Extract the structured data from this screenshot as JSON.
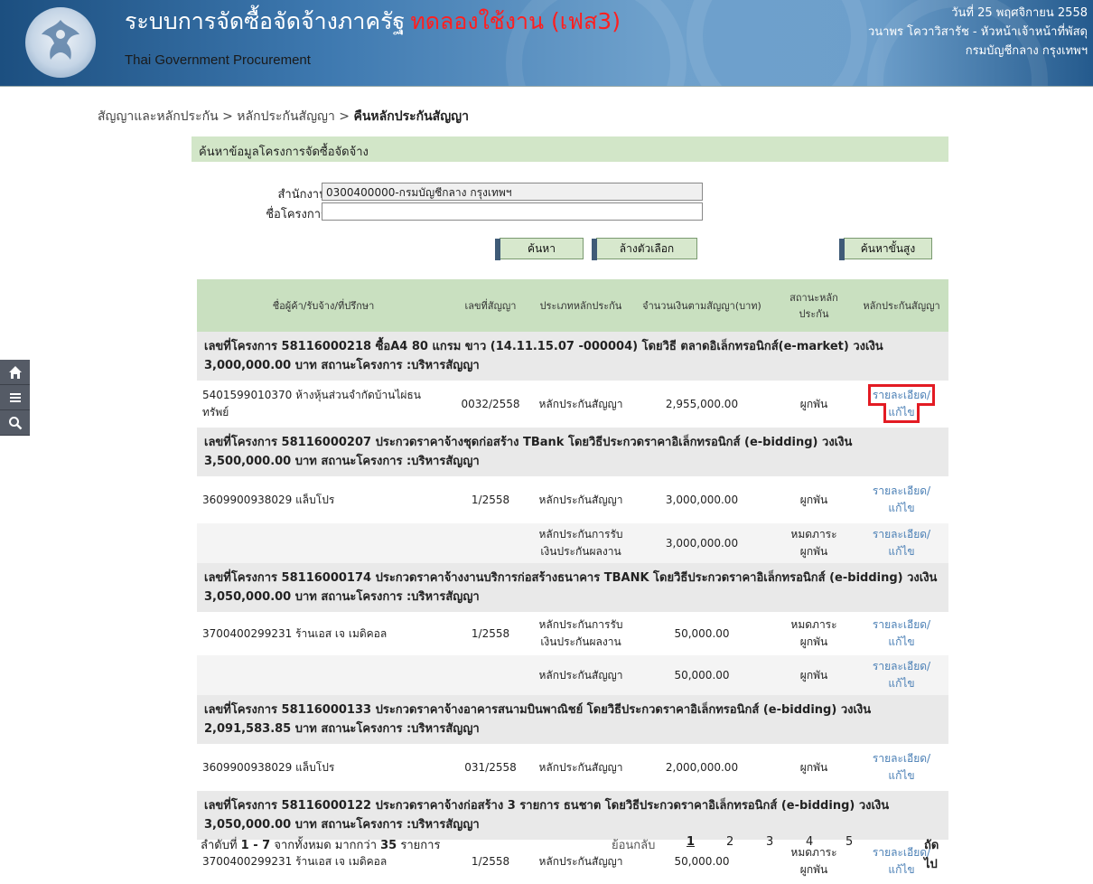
{
  "header": {
    "title": "ระบบการจัดซื้อจัดจ้างภาครัฐ",
    "trial_label": "ทดลองใช้งาน (เฟส3)",
    "subtitle": "Thai Government Procurement",
    "date": "วันที่ 25 พฤศจิกายน 2558",
    "user": "วนาพร โควาวิสารัช - หัวหน้าเจ้าหน้าที่พัสดุ",
    "department": "กรมบัญชีกลาง กรุงเทพฯ",
    "colors": {
      "bar": "#3e79b0",
      "trial": "#ff1f1f"
    }
  },
  "breadcrumb": {
    "item1": "สัญญาและหลักประกัน",
    "sep": ">",
    "item2": "หลักประกันสัญญา",
    "current": "คืนหลักประกันสัญญา"
  },
  "side_tools": [
    "home-icon",
    "menu-icon",
    "search-icon"
  ],
  "search_panel": {
    "heading": "ค้นหาข้อมูลโครงการจัดซื้อจัดจ้าง",
    "agency_label": "สำนักงาน",
    "agency_value": "0300400000-กรมบัญชีกลาง กรุงเทพฯ",
    "project_label": "ชื่อโครงการ",
    "project_value": "",
    "search_button": "ค้นหา",
    "clear_button": "ล้างตัวเลือก",
    "advanced_button": "ค้นหาขั้นสูง"
  },
  "table": {
    "columns": {
      "vendor": "ชื่อผู้ค้า/รับจ้าง/ที่ปรึกษา",
      "contract_no": "เลขที่สัญญา",
      "guarantee_type": "ประเภทหลักประกัน",
      "amount": "จำนวนเงินตามสัญญา(บาท)",
      "status": "สถานะหลักประกัน",
      "guarantee": "หลักประกันสัญญา"
    },
    "projects": [
      {
        "header": "เลขที่โครงการ 58116000218 ซื้อA4 80 แกรม ขาว (14.11.15.07 -000004) โดยวิธี ตลาดอิเล็กทรอนิกส์(e-market) วงเงิน 3,000,000.00 บาท สถานะโครงการ :บริหารสัญญา",
        "rows": [
          {
            "vendor": "5401599010370 ห้างหุ้นส่วนจำกัดบ้านไผ่ธนทรัพย์",
            "contract_no": "0032/2558",
            "type": "หลักประกันสัญญา",
            "amount": "2,955,000.00",
            "status": "ผูกพัน",
            "action": "รายละเอียด/แก้ไข"
          }
        ]
      },
      {
        "header": "เลขที่โครงการ 58116000207 ประกวดราคาจ้างชุดก่อสร้าง TBank โดยวิธีประกวดราคาอิเล็กทรอนิกส์ (e-bidding) วงเงิน 3,500,000.00 บาท สถานะโครงการ :บริหารสัญญา",
        "rows": [
          {
            "vendor": "3609900938029 แล็บโปร",
            "contract_no": "1/2558",
            "type": "หลักประกันสัญญา",
            "amount": "3,000,000.00",
            "status": "ผูกพัน",
            "action": "รายละเอียด/แก้ไข"
          },
          {
            "vendor": "",
            "contract_no": "",
            "type": "หลักประกันการรับเงินประกันผลงาน",
            "amount": "3,000,000.00",
            "status": "หมดภาระผูกพัน",
            "action": "รายละเอียด/แก้ไข"
          }
        ]
      },
      {
        "header": "เลขที่โครงการ 58116000174 ประกวดราคาจ้างงานบริการก่อสร้างธนาคาร TBANK โดยวิธีประกวดราคาอิเล็กทรอนิกส์ (e-bidding) วงเงิน 3,050,000.00 บาท สถานะโครงการ :บริหารสัญญา",
        "rows": [
          {
            "vendor": "3700400299231 ร้านเอส เจ เมดิคอล",
            "contract_no": "1/2558",
            "type": "หลักประกันการรับเงินประกันผลงาน",
            "amount": "50,000.00",
            "status": "หมดภาระผูกพัน",
            "action": "รายละเอียด/แก้ไข"
          },
          {
            "vendor": "",
            "contract_no": "",
            "type": "หลักประกันสัญญา",
            "amount": "50,000.00",
            "status": "ผูกพัน",
            "action": "รายละเอียด/แก้ไข"
          }
        ]
      },
      {
        "header": "เลขที่โครงการ 58116000133 ประกวดราคาจ้างอาคารสนามบินพาณิชย์ โดยวิธีประกวดราคาอิเล็กทรอนิกส์ (e-bidding) วงเงิน 2,091,583.85 บาท สถานะโครงการ :บริหารสัญญา",
        "rows": [
          {
            "vendor": "3609900938029 แล็บโปร",
            "contract_no": "031/2558",
            "type": "หลักประกันสัญญา",
            "amount": "2,000,000.00",
            "status": "ผูกพัน",
            "action": "รายละเอียด/แก้ไข"
          }
        ]
      },
      {
        "header": "เลขที่โครงการ 58116000122 ประกวดราคาจ้างก่อสร้าง 3 รายการ ธนชาต โดยวิธีประกวดราคาอิเล็กทรอนิกส์ (e-bidding) วงเงิน 3,050,000.00 บาท สถานะโครงการ :บริหารสัญญา",
        "rows": [
          {
            "vendor": "3700400299231 ร้านเอส เจ เมดิคอล",
            "contract_no": "1/2558",
            "type": "หลักประกันสัญญา",
            "amount": "50,000.00",
            "status": "หมดภาระผูกพัน",
            "action": "รายละเอียด/แก้ไข"
          }
        ]
      }
    ]
  },
  "pager": {
    "summary_prefix": "ลำดับที่",
    "summary_range": "1 - 7",
    "summary_mid": "จากทั้งหมด มากกว่า",
    "summary_total": "35",
    "summary_suffix": "รายการ",
    "back": "ย้อนกลับ",
    "pages": [
      "1",
      "2",
      "3",
      "4",
      "5"
    ],
    "current_page": "1",
    "next": "ถัดไป"
  }
}
